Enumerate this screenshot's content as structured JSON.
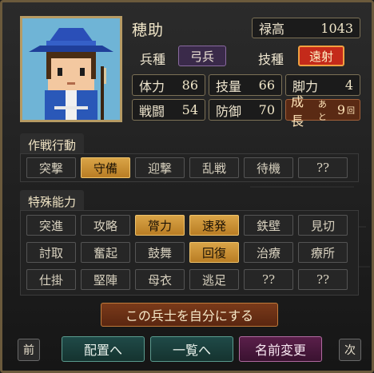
{
  "unit": {
    "name": "穂助",
    "troop_type_label": "兵種",
    "troop_type_value": "弓兵",
    "skill_type_label": "技種",
    "skill_type_value": "遠射",
    "salary_label": "禄高",
    "salary_value": "1043"
  },
  "stats": {
    "hp_label": "体力",
    "hp_value": "86",
    "skill_label": "技量",
    "skill_value": "66",
    "speed_label": "脚力",
    "speed_value": "4",
    "attack_label": "戦闘",
    "attack_value": "54",
    "defense_label": "防御",
    "defense_value": "70",
    "growth_label": "成長",
    "growth_mid": "あと",
    "growth_value": "9",
    "growth_unit": "回"
  },
  "tactics": {
    "title": "作戦行動",
    "items": [
      {
        "label": "突撃",
        "active": false
      },
      {
        "label": "守備",
        "active": true
      },
      {
        "label": "迎撃",
        "active": false
      },
      {
        "label": "乱戦",
        "active": false
      },
      {
        "label": "待機",
        "active": false
      },
      {
        "label": "??",
        "active": false
      }
    ]
  },
  "abilities": {
    "title": "特殊能力",
    "items": [
      {
        "label": "突進",
        "active": false
      },
      {
        "label": "攻略",
        "active": false
      },
      {
        "label": "膂力",
        "active": true
      },
      {
        "label": "速発",
        "active": true
      },
      {
        "label": "鉄壁",
        "active": false
      },
      {
        "label": "見切",
        "active": false
      },
      {
        "label": "討取",
        "active": false
      },
      {
        "label": "奮起",
        "active": false
      },
      {
        "label": "鼓舞",
        "active": false
      },
      {
        "label": "回復",
        "active": true
      },
      {
        "label": "治療",
        "active": false
      },
      {
        "label": "療所",
        "active": false
      },
      {
        "label": "仕掛",
        "active": false
      },
      {
        "label": "堅陣",
        "active": false
      },
      {
        "label": "母衣",
        "active": false
      },
      {
        "label": "逃足",
        "active": false
      },
      {
        "label": "??",
        "active": false
      },
      {
        "label": "??",
        "active": false
      }
    ]
  },
  "actions": {
    "make_own": "この兵士を自分にする",
    "prev": "前",
    "next": "次",
    "deploy": "配置へ",
    "list": "一覧へ",
    "rename": "名前変更"
  }
}
